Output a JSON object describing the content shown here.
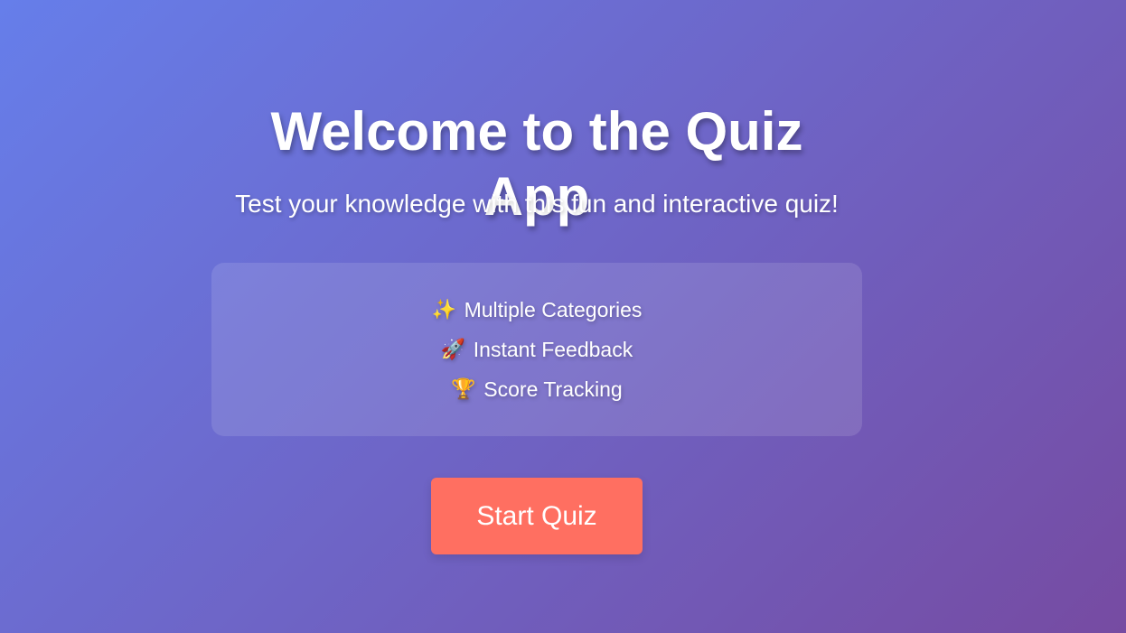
{
  "welcome": {
    "title": "Welcome to the Quiz App",
    "subtitle": "Test your knowledge with this fun and interactive quiz!"
  },
  "features": [
    {
      "icon": "sparkles-icon",
      "emoji": "✨",
      "label": "Multiple Categories"
    },
    {
      "icon": "rocket-icon",
      "emoji": "🚀",
      "label": "Instant Feedback"
    },
    {
      "icon": "trophy-icon",
      "emoji": "🏆",
      "label": "Score Tracking"
    }
  ],
  "start_button": {
    "label": "Start Quiz"
  },
  "colors": {
    "gradient_start": "#667eea",
    "gradient_end": "#764ba2",
    "accent": "#ff6f61"
  }
}
